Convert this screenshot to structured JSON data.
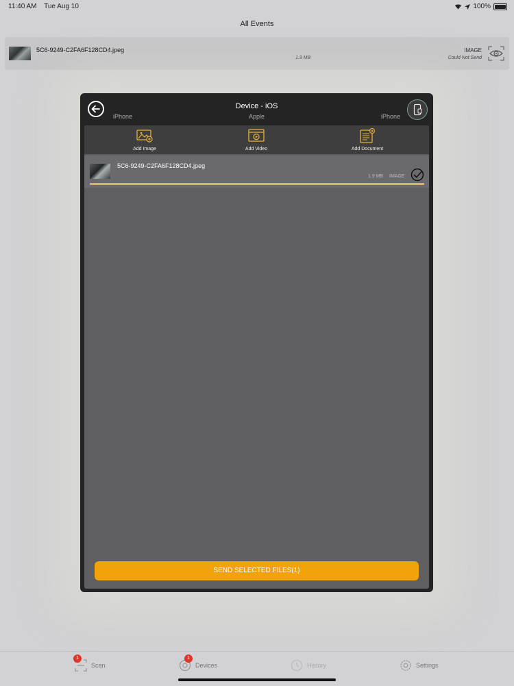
{
  "status_bar": {
    "time": "11:40 AM",
    "date": "Tue Aug 10",
    "battery": "100%"
  },
  "page_title": "All Events",
  "event": {
    "file_name": "5C6-9249-C2FA6F128CD4.jpeg",
    "size": "1.9 MB",
    "type": "IMAGE",
    "status": "Could Not Send",
    "icon": "eye-icon"
  },
  "modal": {
    "title": "Device - iOS",
    "subtitle": "Apple",
    "left_label": "iPhone",
    "right_label": "iPhone",
    "actions": [
      {
        "label": "Add Image",
        "icon": "add-image-icon"
      },
      {
        "label": "Add Video",
        "icon": "add-video-icon"
      },
      {
        "label": "Add Document",
        "icon": "add-document-icon"
      }
    ],
    "file": {
      "name": "5C6-9249-C2FA6F128CD4.jpeg",
      "size": "1.9 MB",
      "type": "IMAGE",
      "selected": true,
      "progress": 1.0
    },
    "send_label": "SEND SELECTED FILES(1)"
  },
  "tabs": [
    {
      "label": "Scan",
      "badge": "1",
      "icon": "scan-icon"
    },
    {
      "label": "Devices",
      "badge": "1",
      "icon": "devices-icon"
    },
    {
      "label": "History",
      "badge": "",
      "icon": "history-icon"
    },
    {
      "label": "Settings",
      "badge": "",
      "icon": "settings-icon"
    }
  ],
  "colors": {
    "accent": "#F2A30A",
    "icon_gold": "#E8B23A",
    "badge": "#E0352B",
    "progress": "#D9B35A"
  }
}
